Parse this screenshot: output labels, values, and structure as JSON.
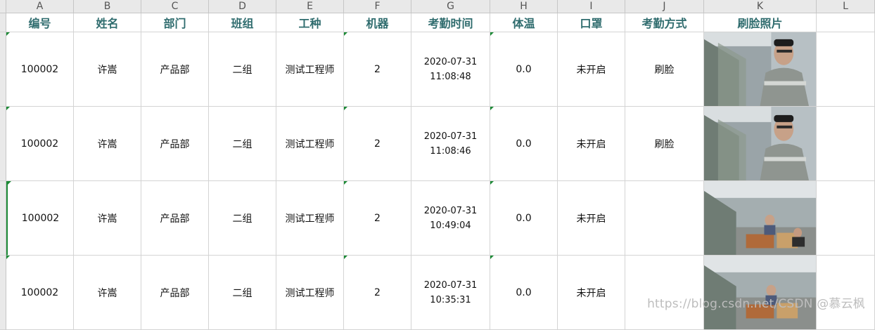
{
  "columns": [
    "A",
    "B",
    "C",
    "D",
    "E",
    "F",
    "G",
    "H",
    "I",
    "J",
    "K",
    "L"
  ],
  "headers": [
    "编号",
    "姓名",
    "部门",
    "班组",
    "工种",
    "机器",
    "考勤时间",
    "体温",
    "口罩",
    "考勤方式",
    "刷脸照片"
  ],
  "rows": [
    {
      "id": "100002",
      "name": "许嵩",
      "dept": "产品部",
      "group": "二组",
      "job": "测试工程师",
      "machine": "2",
      "date": "2020-07-31",
      "time": "11:08:48",
      "temp": "0.0",
      "mask": "未开启",
      "method": "刷脸"
    },
    {
      "id": "100002",
      "name": "许嵩",
      "dept": "产品部",
      "group": "二组",
      "job": "测试工程师",
      "machine": "2",
      "date": "2020-07-31",
      "time": "11:08:46",
      "temp": "0.0",
      "mask": "未开启",
      "method": "刷脸"
    },
    {
      "id": "100002",
      "name": "许嵩",
      "dept": "产品部",
      "group": "二组",
      "job": "测试工程师",
      "machine": "2",
      "date": "2020-07-31",
      "time": "10:49:04",
      "temp": "0.0",
      "mask": "未开启",
      "method": ""
    },
    {
      "id": "100002",
      "name": "许嵩",
      "dept": "产品部",
      "group": "二组",
      "job": "测试工程师",
      "machine": "2",
      "date": "2020-07-31",
      "time": "10:35:31",
      "temp": "0.0",
      "mask": "未开启",
      "method": ""
    }
  ],
  "watermark": "https://blog.csdn.net/CSDN @慕云枫"
}
